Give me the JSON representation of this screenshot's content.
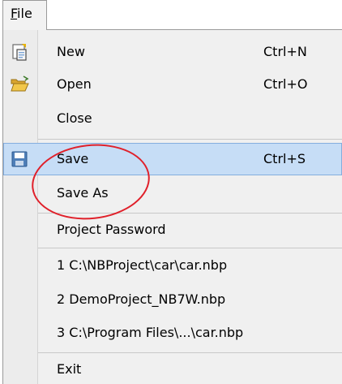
{
  "menubar": {
    "file_label": "File"
  },
  "menu": {
    "items": [
      {
        "key": "new",
        "label": "New",
        "shortcut": "Ctrl+N",
        "icon": "new-document-icon"
      },
      {
        "key": "open",
        "label": "Open",
        "shortcut": "Ctrl+O",
        "icon": "open-folder-icon"
      },
      {
        "key": "close",
        "label": "Close",
        "shortcut": ""
      },
      {
        "key": "save",
        "label": "Save",
        "shortcut": "Ctrl+S",
        "icon": "floppy-disk-icon",
        "highlighted": true
      },
      {
        "key": "save_as",
        "label": "Save As",
        "shortcut": ""
      },
      {
        "key": "project_password",
        "label": "Project Password",
        "shortcut": ""
      },
      {
        "key": "recent1",
        "label": "1 C:\\NBProject\\car\\car.nbp",
        "shortcut": ""
      },
      {
        "key": "recent2",
        "label": "2 DemoProject_NB7W.nbp",
        "shortcut": ""
      },
      {
        "key": "recent3",
        "label": "3 C:\\Program Files\\...\\car.nbp",
        "shortcut": ""
      },
      {
        "key": "exit",
        "label": "Exit",
        "shortcut": ""
      }
    ]
  },
  "colors": {
    "highlight_fill": "#c6ddf6",
    "highlight_border": "#84aede",
    "annotation_circle": "#e0202a"
  }
}
